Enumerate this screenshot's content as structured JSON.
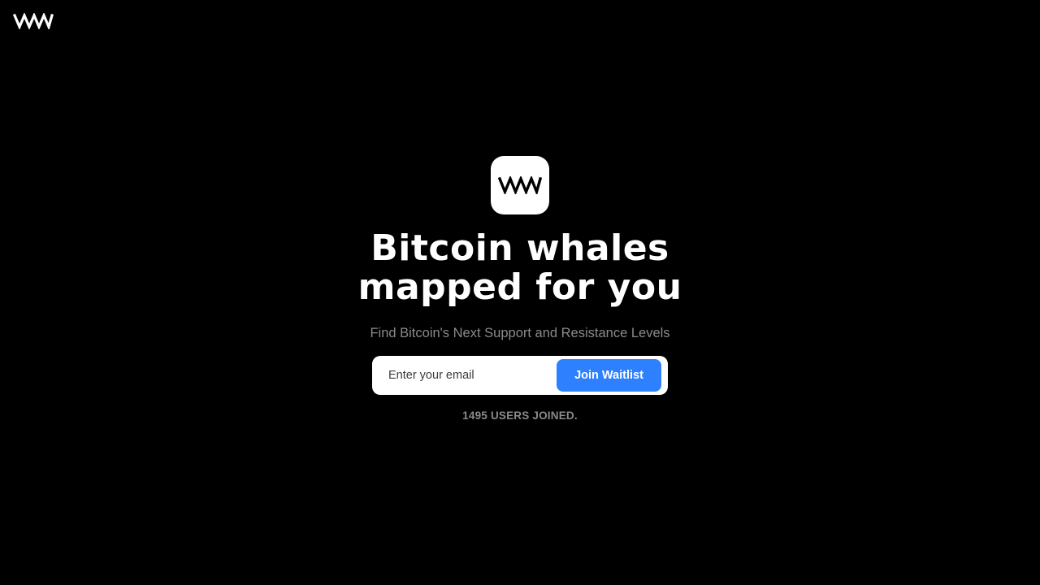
{
  "brand": {
    "logo_icon": "wave-logo-icon"
  },
  "hero": {
    "app_icon": "wave-logo-icon",
    "headline_line1": "Bitcoin whales",
    "headline_line2": "mapped for you",
    "subtitle": "Find Bitcoin's Next Support and Resistance Levels"
  },
  "signup": {
    "email_placeholder": "Enter your email",
    "email_value": "",
    "join_label": "Join Waitlist"
  },
  "stats": {
    "users_joined": "1495 USERS JOINED."
  },
  "colors": {
    "background": "#000000",
    "accent": "#2f80ff",
    "muted_text": "#8a8a8a"
  }
}
